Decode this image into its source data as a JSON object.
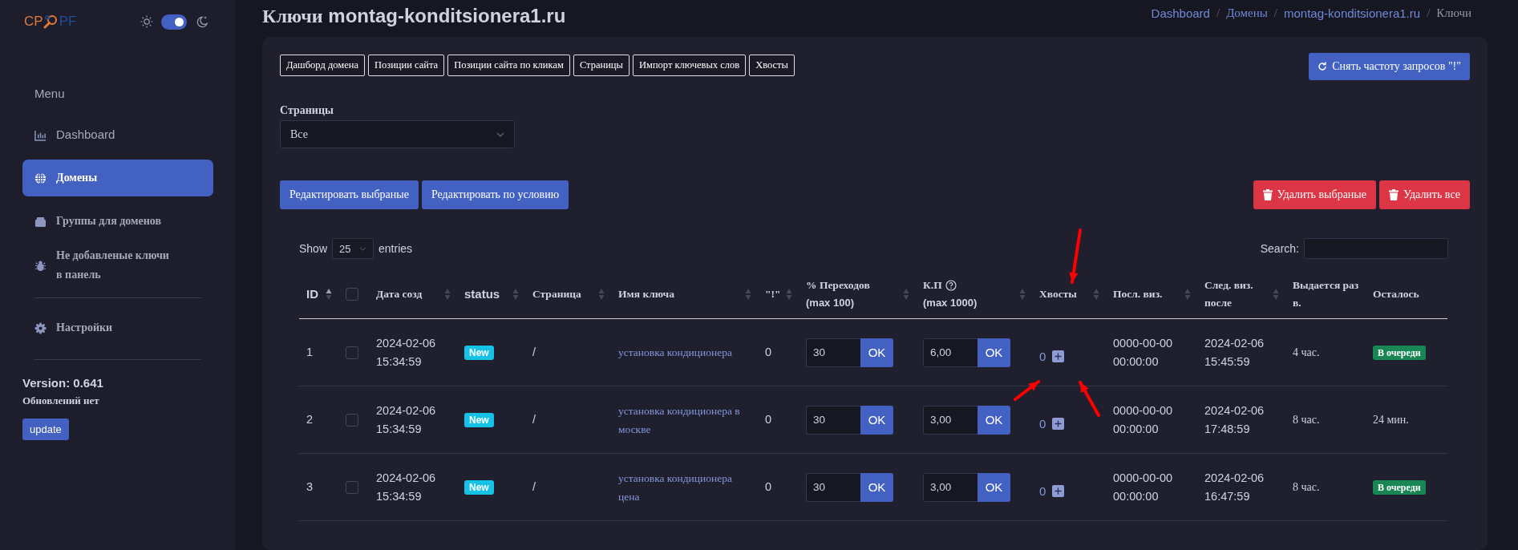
{
  "sidebar": {
    "logo": {
      "left": "CP",
      "right": "PF"
    },
    "theme_toggle": {
      "on": true
    },
    "menu_title": "Menu",
    "items": [
      {
        "label": "Dashboard",
        "selected": false
      },
      {
        "label": "Домены",
        "selected": true
      },
      {
        "label": "Группы для доменов",
        "selected": false
      },
      {
        "label": "Не добавленые ключи в панель",
        "selected": false
      }
    ],
    "footer_items": [
      {
        "label": "Настройки",
        "selected": false
      }
    ],
    "version": "Version: 0.641",
    "update_status": "Обновлений нет",
    "update_button": "update"
  },
  "page_title": {
    "prefix": "Ключи",
    "domain": "montag-konditsionera1.ru"
  },
  "breadcrumbs": [
    {
      "label": "Dashboard",
      "link": true
    },
    {
      "separator": "/",
      "label": "Домены",
      "link": true
    },
    {
      "separator": "/",
      "label": "montag-konditsionera1.ru",
      "link": true
    },
    {
      "separator": "/",
      "label": "Ключи",
      "link": false
    }
  ],
  "nav_tabs": [
    "Дашборд домена",
    "Позиции сайта",
    "Позиции сайта по кликам",
    "Страницы",
    "Импорт ключевых слов",
    "Хвосты"
  ],
  "refresh_button": "Снять частоту запросов \"!\"",
  "pages_filter": {
    "label": "Страницы",
    "value": "Все"
  },
  "edit_buttons": [
    "Редактировать выбраные",
    "Редактировать по условию"
  ],
  "delete_buttons": [
    "Удалить выбраные",
    "Удалить все"
  ],
  "table": {
    "length": {
      "prefix": "Show",
      "value": "25",
      "suffix": "entries"
    },
    "search": {
      "label": "Search:"
    },
    "columns": [
      {
        "kind": "text",
        "label": "ID",
        "sortable": true,
        "sorted_ascending": true
      },
      {
        "kind": "checkbox",
        "checked": false
      },
      {
        "kind": "text",
        "label": "Дата созд",
        "sortable": true,
        "sorted_ascending": false
      },
      {
        "kind": "text",
        "label": "status",
        "sortable": true,
        "sorted_ascending": false
      },
      {
        "kind": "text",
        "label": "Страница",
        "sortable": true,
        "sorted_ascending": false
      },
      {
        "kind": "text",
        "label": "Имя ключа",
        "sortable": true,
        "sorted_ascending": false
      },
      {
        "kind": "text",
        "label": "\"!\"",
        "sortable": true,
        "sorted_ascending": false
      },
      {
        "kind": "text",
        "label": "% Переходов",
        "sublabel": "(max 100)",
        "sortable": true,
        "sorted_ascending": false
      },
      {
        "kind": "help",
        "label": "К.П",
        "sublabel": "(max 1000)",
        "sortable": true,
        "sorted_ascending": false
      },
      {
        "kind": "text",
        "label": "Хвосты",
        "sortable": true,
        "sorted_ascending": false
      },
      {
        "kind": "text",
        "label": "Посл. виз.",
        "sortable": true,
        "sorted_ascending": false
      },
      {
        "kind": "text",
        "label": "След. виз. после",
        "sortable": true,
        "sorted_ascending": false
      },
      {
        "kind": "text",
        "label": "Выдается раз в.",
        "sortable": false
      },
      {
        "kind": "text",
        "label": "Осталось",
        "sortable": false
      }
    ],
    "rows": [
      {
        "id": "1",
        "checked": false,
        "created": [
          "2024-02-06",
          "15:34:59"
        ],
        "status": "New",
        "page": "/",
        "key": "установка кондиционера",
        "excl": "0",
        "transitions": "30",
        "kp": "6,00",
        "ok_transitions": "OK",
        "ok_kp": "OK",
        "tails": "0",
        "last_visit": [
          "0000-00-00",
          "00:00:00"
        ],
        "next_visit": [
          "2024-02-06",
          "15:45:59"
        ],
        "period": "4 час.",
        "remaining": {
          "kind": "badge",
          "text": "В очереди"
        }
      },
      {
        "id": "2",
        "checked": false,
        "created": [
          "2024-02-06",
          "15:34:59"
        ],
        "status": "New",
        "page": "/",
        "key": "установка кондиционера в москве",
        "excl": "0",
        "transitions": "30",
        "kp": "3,00",
        "ok_transitions": "OK",
        "ok_kp": "OK",
        "tails": "0",
        "last_visit": [
          "0000-00-00",
          "00:00:00"
        ],
        "next_visit": [
          "2024-02-06",
          "17:48:59"
        ],
        "period": "8 час.",
        "remaining": {
          "kind": "text",
          "text": "24 мин."
        }
      },
      {
        "id": "3",
        "checked": false,
        "created": [
          "2024-02-06",
          "15:34:59"
        ],
        "status": "New",
        "page": "/",
        "key": "установка кондиционера цена",
        "excl": "0",
        "transitions": "30",
        "kp": "3,00",
        "ok_transitions": "OK",
        "ok_kp": "OK",
        "tails": "0",
        "last_visit": [
          "0000-00-00",
          "00:00:00"
        ],
        "next_visit": [
          "2024-02-06",
          "16:47:59"
        ],
        "period": "8 час.",
        "remaining": {
          "kind": "badge",
          "text": "В очереди"
        }
      }
    ]
  },
  "annotation_arrows": [
    {
      "kind": "down"
    },
    {
      "kind": "up-right"
    },
    {
      "kind": "up-left"
    }
  ]
}
